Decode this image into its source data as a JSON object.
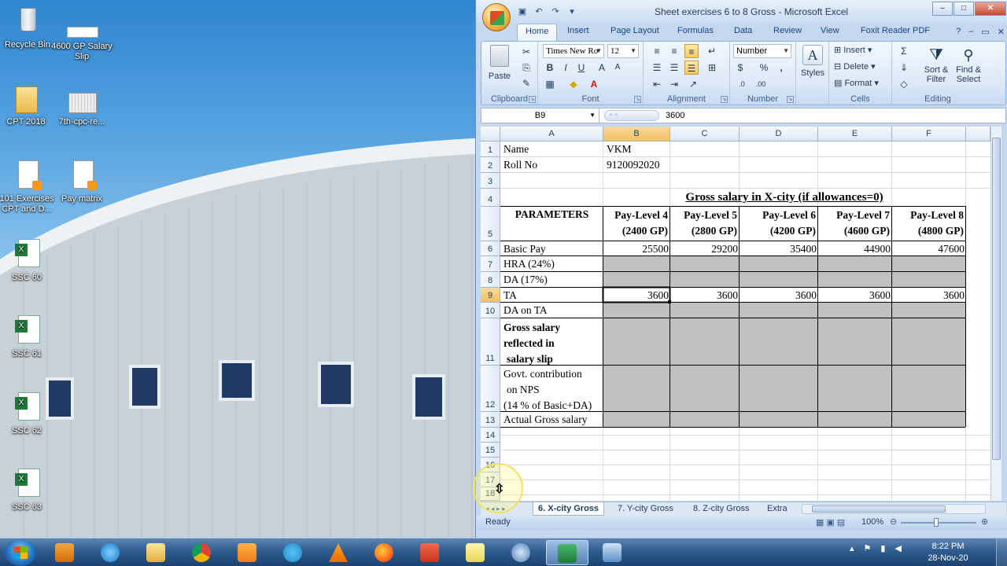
{
  "desktop": {
    "icons": [
      {
        "label": "Recycle Bin"
      },
      {
        "label": "4600 GP Salary Slip"
      },
      {
        "label": "CPT 2018"
      },
      {
        "label": "7th-cpc-re..."
      },
      {
        "label": "101 Exercises CPT and D..."
      },
      {
        "label": "Pay matrix"
      },
      {
        "label": "SSC 60"
      },
      {
        "label": "SSC 61"
      },
      {
        "label": "SSC 62"
      },
      {
        "label": "SSC 63"
      }
    ]
  },
  "window": {
    "title": "Sheet exercises 6 to 8 Gross - Microsoft Excel",
    "controls": {
      "minimize": "–",
      "maximize": "□",
      "close": "✕"
    }
  },
  "ribbon": {
    "tabs": [
      "Home",
      "Insert",
      "Page Layout",
      "Formulas",
      "Data",
      "Review",
      "View",
      "Foxit Reader PDF"
    ],
    "active_tab": "Home",
    "groups": {
      "clipboard": {
        "label": "Clipboard",
        "paste": "Paste"
      },
      "font": {
        "label": "Font",
        "font_name": "Times New Ro",
        "font_size": "12",
        "bold": "B",
        "italic": "I",
        "underline": "U"
      },
      "alignment": {
        "label": "Alignment"
      },
      "number": {
        "label": "Number",
        "format": "Number",
        "currency": "$",
        "percent": "%",
        "comma": ","
      },
      "styles": {
        "label": "",
        "styles": "Styles"
      },
      "cells": {
        "label": "Cells",
        "insert": "Insert",
        "delete": "Delete",
        "format": "Format"
      },
      "editing": {
        "label": "Editing",
        "sort_filter": "Sort & Filter",
        "find_select": "Find & Select"
      }
    }
  },
  "formula_bar": {
    "name_box": "B9",
    "value": "3600"
  },
  "grid": {
    "columns": [
      "A",
      "B",
      "C",
      "D",
      "E",
      "F"
    ],
    "selected_column": "B",
    "rows": [
      "1",
      "2",
      "3",
      "4",
      "5",
      "6",
      "7",
      "8",
      "9",
      "10",
      "11",
      "12",
      "13",
      "14",
      "15",
      "16",
      "17",
      "18"
    ],
    "selected_row": "9",
    "cells": {
      "a1": "Name",
      "b1": "VKM",
      "a2": "Roll No",
      "b2": "9120092020",
      "title4": "Gross salary in X-city (if allowances=0)",
      "params": "PARAMETERS",
      "a6": "Basic Pay",
      "a7": "HRA (24%)",
      "a8": "DA (17%)",
      "a9": "TA",
      "a10": "DA on TA",
      "a11_l1": "Gross salary",
      "a11_l2": "reflected in",
      "a11_l3": "salary slip",
      "a12_l1": "Govt. contribution",
      "a12_l2": "on NPS",
      "a12_l3": "(14 % of Basic+DA)",
      "a13": "Actual Gross salary"
    },
    "levels": [
      {
        "name": "Pay-Level 4",
        "gp": "(2400 GP)",
        "basic": "25500",
        "ta": "3600"
      },
      {
        "name": "Pay-Level 5",
        "gp": "(2800 GP)",
        "basic": "29200",
        "ta": "3600"
      },
      {
        "name": "Pay-Level 6",
        "gp": "(4200 GP)",
        "basic": "35400",
        "ta": "3600"
      },
      {
        "name": "Pay-Level 7",
        "gp": "(4600 GP)",
        "basic": "44900",
        "ta": "3600"
      },
      {
        "name": "Pay-Level 8",
        "gp": "(4800 GP)",
        "basic": "47600",
        "ta": "3600"
      }
    ]
  },
  "sheet_tabs": [
    "6. X-city Gross",
    "7. Y-city Gross",
    "8. Z-city Gross",
    "Extra"
  ],
  "active_sheet": "6. X-city Gross",
  "status": {
    "text": "Ready",
    "zoom": "100%"
  },
  "taskbar": {
    "time": "8:22 PM",
    "date": "28-Nov-20"
  },
  "colors": {
    "shaded_cell": "#c0c0c0",
    "selected_header": "#f7cf7b"
  }
}
